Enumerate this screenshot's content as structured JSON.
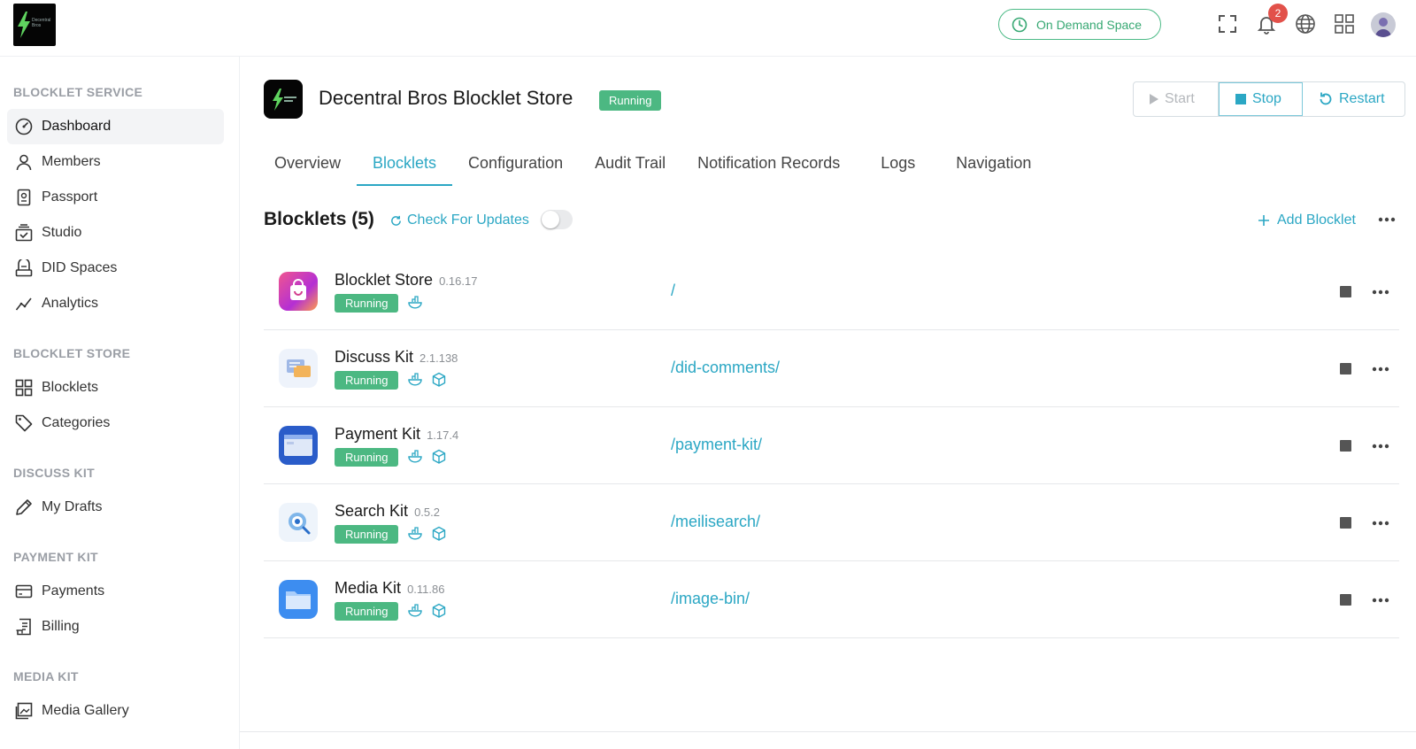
{
  "topbar": {
    "logo_text": "Decentral Bros",
    "space_button": "On Demand Space",
    "notification_count": "2"
  },
  "sidebar": {
    "sections": [
      {
        "title": "BLOCKLET SERVICE",
        "items": [
          {
            "label": "Dashboard",
            "icon": "dashboard-icon",
            "active": true
          },
          {
            "label": "Members",
            "icon": "user-icon"
          },
          {
            "label": "Passport",
            "icon": "passport-icon"
          },
          {
            "label": "Studio",
            "icon": "studio-icon"
          },
          {
            "label": "DID Spaces",
            "icon": "did-spaces-icon"
          },
          {
            "label": "Analytics",
            "icon": "analytics-icon"
          }
        ]
      },
      {
        "title": "BLOCKLET STORE",
        "items": [
          {
            "label": "Blocklets",
            "icon": "grid-icon"
          },
          {
            "label": "Categories",
            "icon": "tag-icon"
          }
        ]
      },
      {
        "title": "DISCUSS KIT",
        "items": [
          {
            "label": "My Drafts",
            "icon": "pen-icon"
          }
        ]
      },
      {
        "title": "PAYMENT KIT",
        "items": [
          {
            "label": "Payments",
            "icon": "card-icon"
          },
          {
            "label": "Billing",
            "icon": "billing-icon"
          }
        ]
      },
      {
        "title": "MEDIA KIT",
        "items": [
          {
            "label": "Media Gallery",
            "icon": "gallery-icon"
          }
        ]
      }
    ]
  },
  "header": {
    "title": "Decentral Bros Blocklet Store",
    "status": "Running",
    "buttons": {
      "start": "Start",
      "stop": "Stop",
      "restart": "Restart"
    }
  },
  "tabs": [
    {
      "label": "Overview"
    },
    {
      "label": "Blocklets",
      "active": true
    },
    {
      "label": "Configuration"
    },
    {
      "label": "Audit Trail"
    },
    {
      "label": "Notification Records"
    },
    {
      "label": "Logs"
    },
    {
      "label": "Navigation"
    }
  ],
  "list": {
    "title": "Blocklets (5)",
    "check_updates": "Check For Updates",
    "add_blocklet": "Add Blocklet",
    "rows": [
      {
        "name": "Blocklet Store",
        "version": "0.16.17",
        "status": "Running",
        "path": "/",
        "icon_color": "#e0407a"
      },
      {
        "name": "Discuss Kit",
        "version": "2.1.138",
        "status": "Running",
        "path": "/did-comments/",
        "icon_color": "#eef3fb"
      },
      {
        "name": "Payment Kit",
        "version": "1.17.4",
        "status": "Running",
        "path": "/payment-kit/",
        "icon_color": "#2a5cc9"
      },
      {
        "name": "Search Kit",
        "version": "0.5.2",
        "status": "Running",
        "path": "/meilisearch/",
        "icon_color": "#eef4fb"
      },
      {
        "name": "Media Kit",
        "version": "0.11.86",
        "status": "Running",
        "path": "/image-bin/",
        "icon_color": "#3d8df0"
      }
    ]
  },
  "colors": {
    "accent": "#2ba7c4",
    "running": "#4cb882",
    "notification": "#e2514a"
  }
}
